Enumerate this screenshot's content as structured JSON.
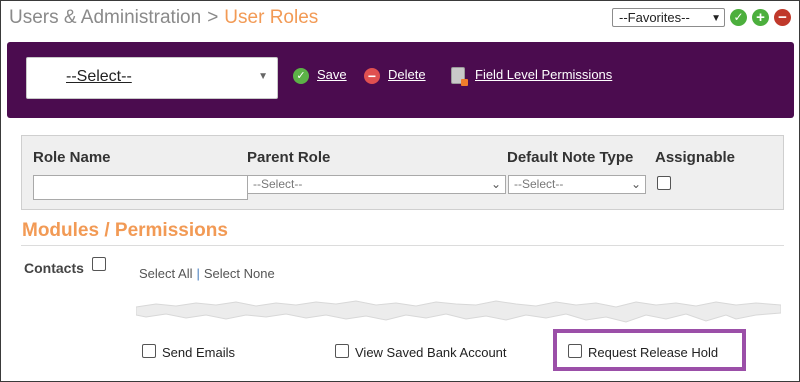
{
  "header": {
    "breadcrumb_parent": "Users & Administration",
    "breadcrumb_separator": ">",
    "breadcrumb_current": "User Roles",
    "favorites_selected": "--Favorites--",
    "icons": [
      "check-circle-icon",
      "plus-circle-icon",
      "minus-circle-icon"
    ]
  },
  "toolbar": {
    "role_select_value": "--Select--",
    "save_label": "Save",
    "delete_label": "Delete",
    "field_level_permissions_label": "Field Level Permissions"
  },
  "role_form": {
    "role_name_label": "Role Name",
    "role_name_value": "",
    "parent_role_label": "Parent Role",
    "parent_role_value": "--Select--",
    "default_note_type_label": "Default Note Type",
    "default_note_type_value": "--Select--",
    "assignable_label": "Assignable",
    "assignable_checked": false
  },
  "modules": {
    "title": "Modules / Permissions",
    "contacts_label": "Contacts",
    "select_all": "Select All",
    "select_separator": "|",
    "select_none": "Select None",
    "permissions": [
      {
        "label": "Send Emails",
        "checked": false
      },
      {
        "label": "View Saved Bank Account",
        "checked": false
      },
      {
        "label": "Request Release Hold",
        "checked": false
      }
    ]
  },
  "colors": {
    "accent_orange": "#f29a55",
    "toolbar_purple": "#4b0c4f",
    "highlight_purple": "#9b4fa8",
    "success_green": "#4caf3d",
    "danger_red": "#c0392b"
  }
}
